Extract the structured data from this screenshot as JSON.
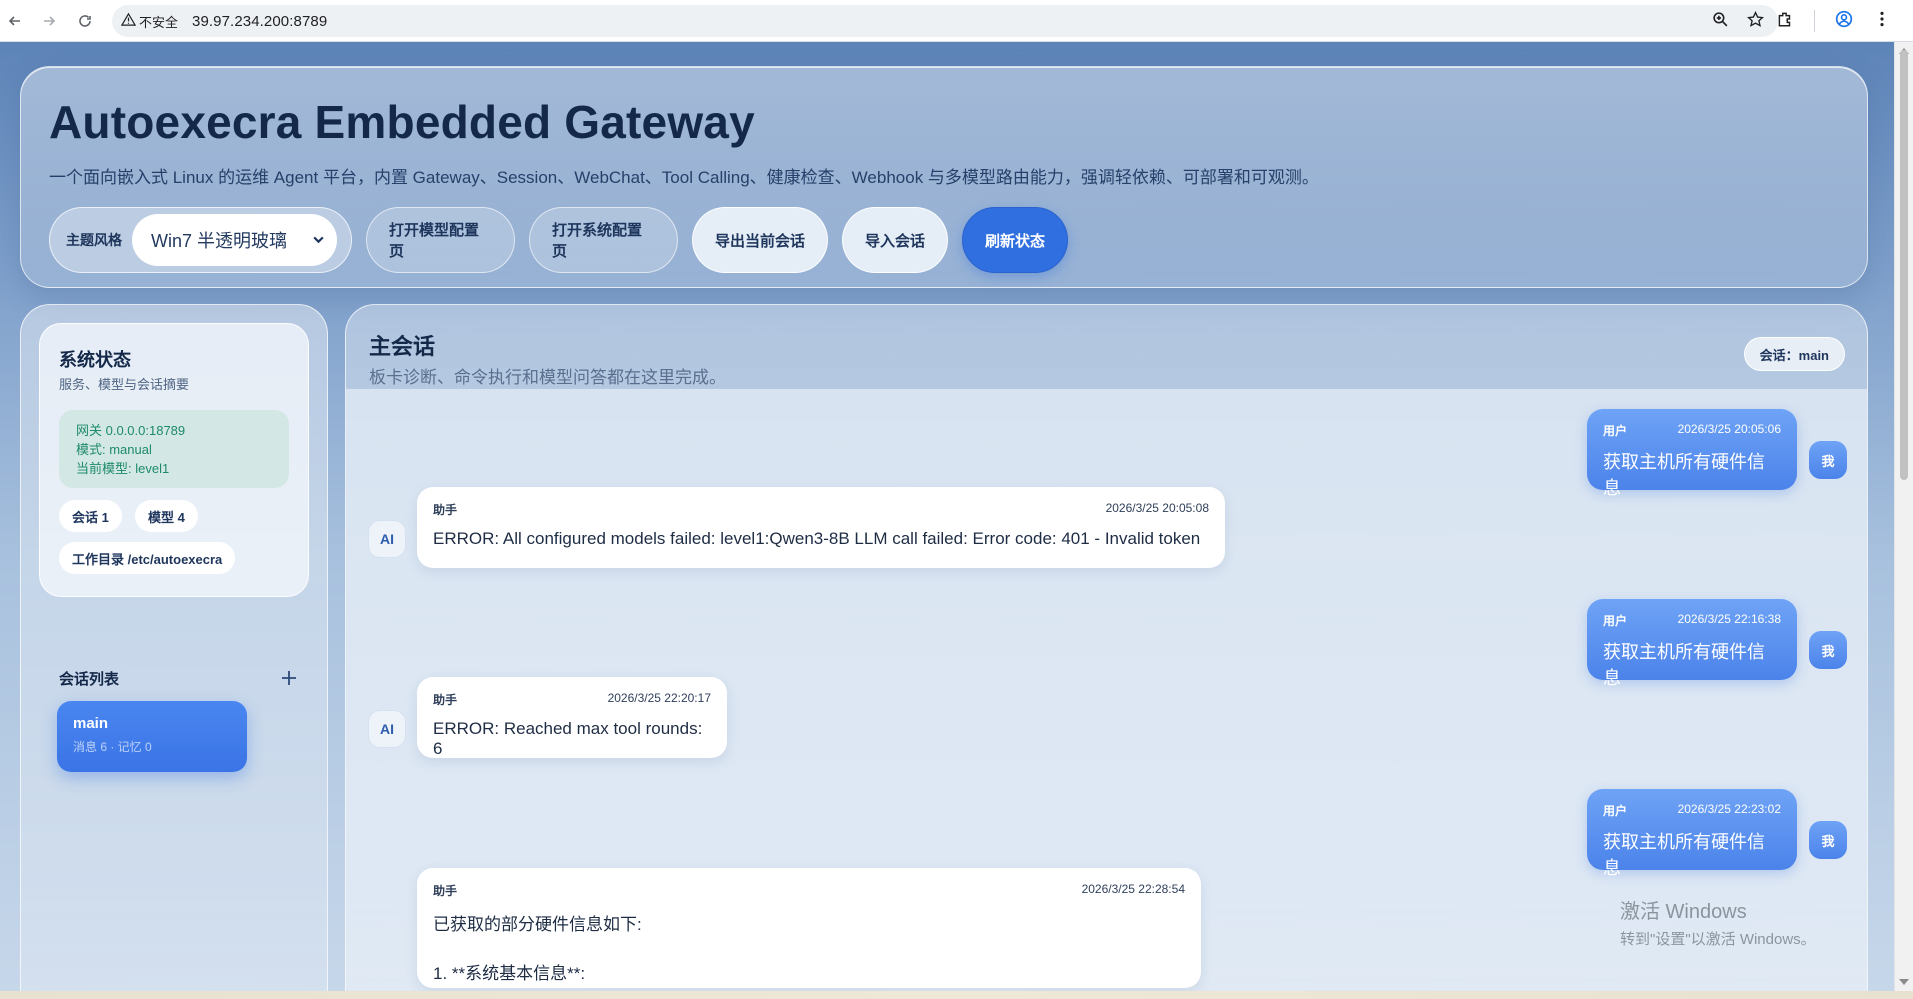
{
  "browser": {
    "insecure_label": "不安全",
    "url": "39.97.234.200:8789"
  },
  "header": {
    "title": "Autoexecra Embedded Gateway",
    "subtitle": "一个面向嵌入式 Linux 的运维 Agent 平台，内置 Gateway、Session、WebChat、Tool Calling、健康检查、Webhook 与多模型路由能力，强调轻依赖、可部署和可观测。",
    "theme_label": "主题风格",
    "theme_value": "Win7 半透明玻璃",
    "buttons": {
      "model_config": "打开模型配置页",
      "system_config": "打开系统配置页",
      "export": "导出当前会话",
      "import": "导入会话",
      "refresh": "刷新状态"
    }
  },
  "sidebar": {
    "status_title": "系统状态",
    "status_subtitle": "服务、模型与会话摘要",
    "gateway": "网关 0.0.0.0:18789",
    "mode": "模式: manual",
    "current_model": "当前模型: level1",
    "chip_sessions": "会话 1",
    "chip_models": "模型 4",
    "chip_workdir": "工作目录 /etc/autoexecra",
    "sessions_title": "会话列表",
    "sessions": [
      {
        "name": "main",
        "meta": "消息 6 · 记忆 0"
      }
    ]
  },
  "chat": {
    "title": "主会话",
    "subtitle": "板卡诊断、命令执行和模型问答都在这里完成。",
    "session_badge": "会话：main",
    "user_avatar": "我",
    "ai_avatar": "AI",
    "messages": [
      {
        "role": "用户",
        "time": "2026/3/25 20:05:06",
        "text": "获取主机所有硬件信息"
      },
      {
        "role": "助手",
        "time": "2026/3/25 20:05:08",
        "text": "ERROR: All configured models failed: level1:Qwen3-8B LLM call failed: Error code: 401 - Invalid token"
      },
      {
        "role": "用户",
        "time": "2026/3/25 22:16:38",
        "text": "获取主机所有硬件信息"
      },
      {
        "role": "助手",
        "time": "2026/3/25 22:20:17",
        "text": "ERROR: Reached max tool rounds: 6"
      },
      {
        "role": "用户",
        "time": "2026/3/25 22:23:02",
        "text": "获取主机所有硬件信息"
      },
      {
        "role": "助手",
        "time": "2026/3/25 22:28:54",
        "text": "已获取的部分硬件信息如下:",
        "text2": "1. **系统基本信息**:"
      }
    ]
  },
  "watermark": {
    "line1": "激活 Windows",
    "line2": "转到\"设置\"以激活 Windows。"
  }
}
